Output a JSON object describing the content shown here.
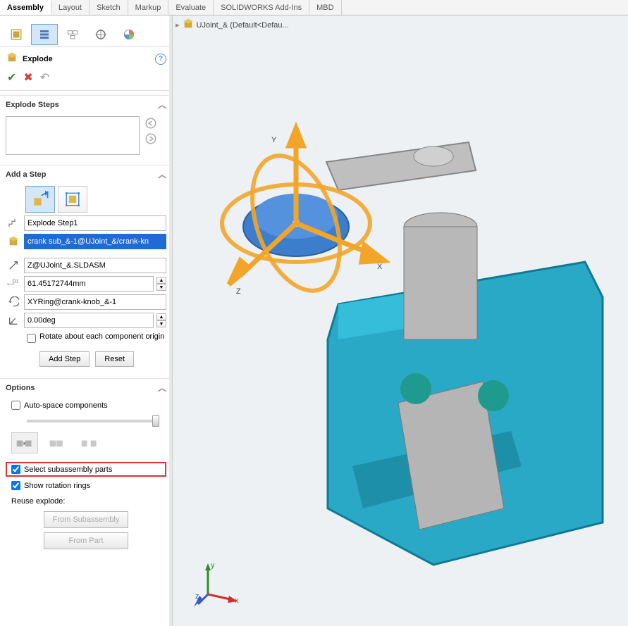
{
  "tabs": [
    "Assembly",
    "Layout",
    "Sketch",
    "Markup",
    "Evaluate",
    "SOLIDWORKS Add-Ins",
    "MBD"
  ],
  "active_tab": "Assembly",
  "breadcrumb": {
    "icon": "assembly",
    "text": "UJoint_&  (Default<Defau..."
  },
  "panel": {
    "feature_title": "Explode",
    "sections": {
      "explode_steps": {
        "title": "Explode Steps"
      },
      "add_step": {
        "title": "Add a Step",
        "step_name": "Explode Step1",
        "component": "crank sub_&-1@UJoint_&/crank-kn",
        "direction": "Z@UJoint_&.SLDASM",
        "distance": "61.45172744mm",
        "ring": "XYRing@crank-knob_&-1",
        "angle": "0.00deg",
        "rotate_origin_label": "Rotate about each component origin",
        "add_btn": "Add Step",
        "reset_btn": "Reset"
      },
      "options": {
        "title": "Options",
        "autospace": "Auto-space components",
        "select_sub": "Select subassembly parts",
        "show_rings": "Show rotation rings",
        "reuse_label": "Reuse explode:",
        "from_sub": "From Subassembly",
        "from_part": "From Part"
      }
    }
  },
  "axes": {
    "x": "X",
    "y": "Y",
    "z": "Z"
  },
  "triad": {
    "x": "x",
    "y": "y",
    "z": "z"
  }
}
